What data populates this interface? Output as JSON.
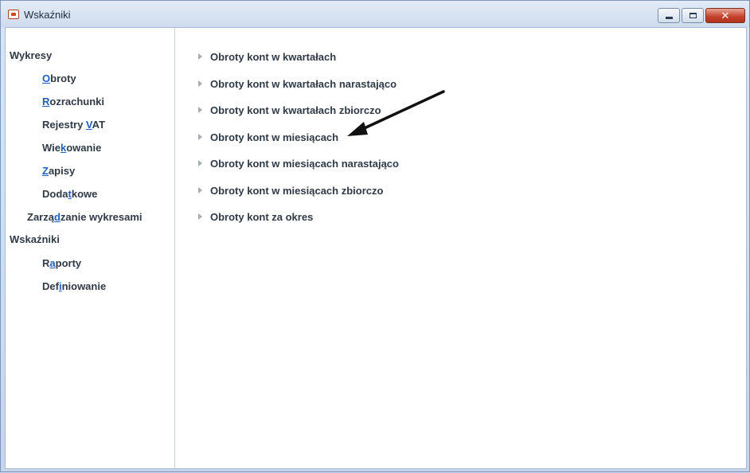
{
  "window": {
    "title": "Wskaźniki",
    "controls": {
      "minimize": "minimize",
      "maximize": "maximize",
      "close": "✕"
    }
  },
  "sidebar": {
    "groups": [
      {
        "label": "Wykresy",
        "items": [
          {
            "pre": "",
            "key": "O",
            "post": "broty"
          },
          {
            "pre": "",
            "key": "R",
            "post": "ozrachunki"
          },
          {
            "pre": "Rejestry ",
            "key": "V",
            "post": "AT"
          },
          {
            "pre": "Wie",
            "key": "k",
            "post": "owanie"
          },
          {
            "pre": "",
            "key": "Z",
            "post": "apisy"
          },
          {
            "pre": "Doda",
            "key": "t",
            "post": "kowe"
          }
        ],
        "extra": {
          "pre": "Zarzą",
          "key": "d",
          "post": "zanie wykresami"
        }
      },
      {
        "label": "Wskaźniki",
        "items": [
          {
            "pre": "R",
            "key": "a",
            "post": "porty"
          },
          {
            "pre": "Def",
            "key": "i",
            "post": "niowanie"
          }
        ]
      }
    ]
  },
  "reports": {
    "items": [
      "Obroty kont w kwartałach",
      "Obroty kont w kwartałach narastająco",
      "Obroty kont w kwartałach zbiorczo",
      "Obroty kont w miesiącach",
      "Obroty kont w miesiącach narastająco",
      "Obroty kont w miesiącach zbiorczo",
      "Obroty kont za okres"
    ]
  },
  "annotation": {
    "icon": "arrow-annotation-icon",
    "color": "#111111"
  }
}
